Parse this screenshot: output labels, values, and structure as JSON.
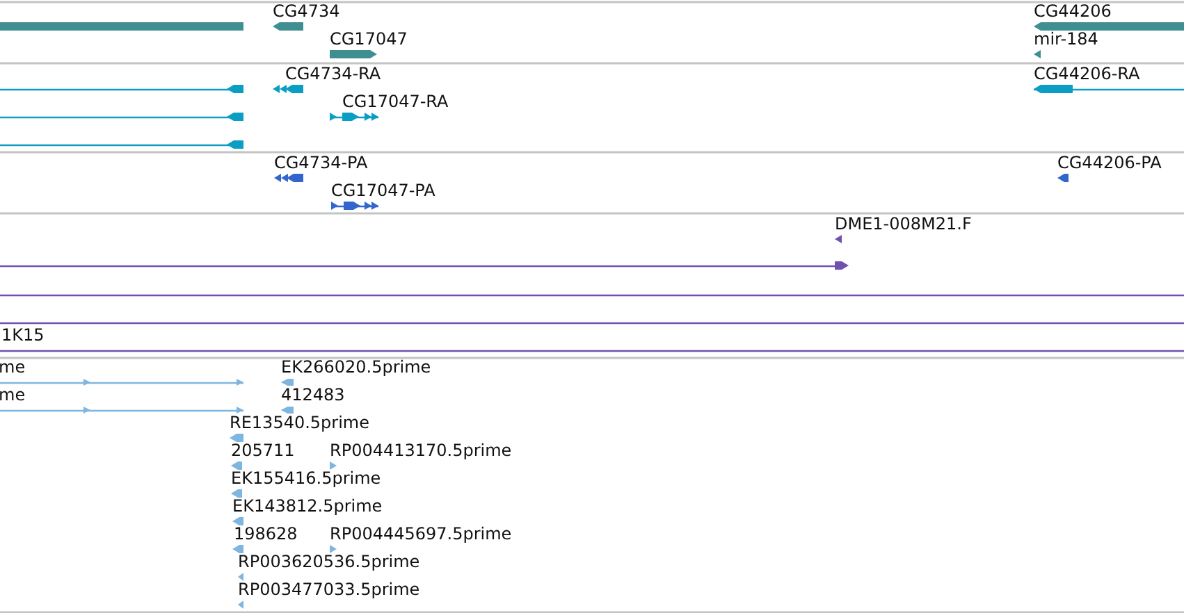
{
  "tracks": [
    {
      "kind": "gene",
      "features": [
        {
          "reverse": true
        },
        {
          "label": "CG4734",
          "reverse": true
        },
        {
          "label": "CG17047",
          "reverse": false
        },
        {
          "label": "CG44206",
          "reverse": true
        },
        {
          "label": "mir-184",
          "reverse": true
        }
      ]
    },
    {
      "kind": "transcript",
      "features": [
        {
          "reverse": true
        },
        {
          "reverse": true
        },
        {
          "reverse": true
        },
        {
          "label": "CG4734-RA",
          "reverse": true
        },
        {
          "label": "CG17047-RA",
          "reverse": false
        },
        {
          "label": "CG44206-RA",
          "reverse": true
        }
      ]
    },
    {
      "kind": "protein",
      "features": [
        {
          "label": "CG4734-PA",
          "reverse": true
        },
        {
          "label": "CG17047-PA",
          "reverse": false
        },
        {
          "label": "CG44206-PA",
          "reverse": true
        }
      ]
    },
    {
      "kind": "clone",
      "features": [
        {
          "kind": "arrow",
          "label": "DME1-008M21.F",
          "reverse": true
        },
        {
          "kind": "arrow",
          "reverse": false
        },
        {
          "kind": "line"
        },
        {
          "kind": "line"
        },
        {
          "kind": "line",
          "label": "1K15"
        }
      ]
    },
    {
      "kind": "est",
      "features": [
        {
          "label": "me",
          "reverse": false
        },
        {
          "label": "me",
          "reverse": false
        },
        {
          "label": "EK266020.5prime",
          "reverse": true
        },
        {
          "label": "412483",
          "reverse": true
        },
        {
          "label": "RE13540.5prime",
          "reverse": true
        },
        {
          "label": "205711",
          "reverse": true
        },
        {
          "label": "RP004413170.5prime",
          "reverse": false
        },
        {
          "label": "EK155416.5prime",
          "reverse": true
        },
        {
          "label": "EK143812.5prime",
          "reverse": true
        },
        {
          "label": "198628",
          "reverse": true
        },
        {
          "label": "RP004445697.5prime",
          "reverse": false
        },
        {
          "label": "RP003620536.5prime",
          "reverse": true
        },
        {
          "label": "RP003477033.5prime",
          "reverse": true
        }
      ]
    }
  ]
}
